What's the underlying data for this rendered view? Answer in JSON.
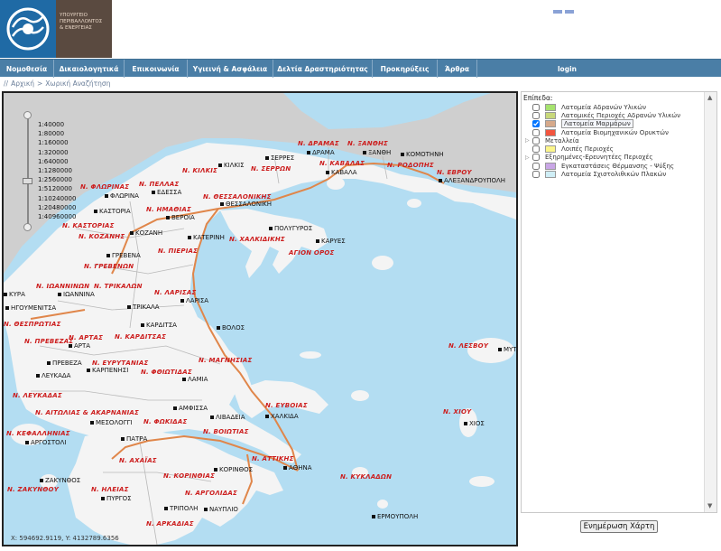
{
  "header": {
    "logo_text": [
      "ΥΠΟΥΡΓΕΙΟ",
      "ΠΕΡΙΒΑΛΛΟΝΤΟΣ",
      "& ΕΝΕΡΓΕΙΑΣ"
    ]
  },
  "nav": {
    "items": [
      "Νομοθεσία",
      "Δικαιολογητικά",
      "Επικοινωνία",
      "Υγιεινή & Ασφάλεια",
      "Δελτία Δραστηριότητας",
      "Προκηρύξεις",
      "Άρθρα"
    ],
    "login": "login"
  },
  "breadcrumb": {
    "prefix": "//",
    "home": "Αρχική",
    "separator": ">",
    "current": "Χωρική Αναζήτηση"
  },
  "map": {
    "scales": [
      "1:40000",
      "1:80000",
      "1:160000",
      "1:320000",
      "1:640000",
      "1:1280000",
      "1:2560000",
      "1:5120000",
      "1:10240000",
      "1:20480000",
      "1:40960000"
    ],
    "coords": "X: 594692.9119, Y: 4132789.6356",
    "prefectures": [
      "Ν. ΔΡΑΜΑΣ",
      "Ν. ΞΑΝΘΗΣ",
      "Ν. ΚΑΒΑΛΑΣ",
      "Ν. ΡΟΔΟΠΗΣ",
      "Ν. ΕΒΡΟΥ",
      "Ν. ΚΙΛΚΙΣ",
      "Ν. ΣΕΡΡΩΝ",
      "Ν. ΠΕΛΛΑΣ",
      "Ν. ΦΛΩΡΙΝΑΣ",
      "Ν. ΘΕΣΣΑΛΟΝΙΚΗΣ",
      "Ν. ΗΜΑΘΙΑΣ",
      "Ν. ΚΑΣΤΟΡΙΑΣ",
      "Ν. ΚΟΖΑΝΗΣ",
      "Ν. ΧΑΛΚΙΔΙΚΗΣ",
      "ΑΓΙΟΝ ΟΡΟΣ",
      "Ν. ΠΙΕΡΙΑΣ",
      "Ν. ΓΡΕΒΕΝΩΝ",
      "Ν. ΙΩΑΝΝΙΝΩΝ",
      "Ν. ΤΡΙΚΑΛΩΝ",
      "Ν. ΛΑΡΙΣΑΣ",
      "Ν. ΘΕΣΠΡΩΤΙΑΣ",
      "Ν. ΠΡΕΒΕΖΑΣ",
      "Ν. ΑΡΤΑΣ",
      "Ν. ΚΑΡΔΙΤΣΑΣ",
      "Ν. ΜΑΓΝΗΣΙΑΣ",
      "Ν. ΕΥΡΥΤΑΝΙΑΣ",
      "Ν. ΦΘΙΩΤΙΔΑΣ",
      "Ν. ΛΕΥΚΑΔΑΣ",
      "Ν. ΑΙΤΩΛΙΑΣ & ΑΚΑΡΝΑΝΙΑΣ",
      "Ν. ΦΩΚΙΔΑΣ",
      "Ν. ΒΟΙΩΤΙΑΣ",
      "Ν. ΕΥΒΟΙΑΣ",
      "Ν. ΚΕΦΑΛΛΗΝΙΑΣ",
      "Ν. ΑΧΑΪΑΣ",
      "Ν. ΚΟΡΙΝΘΙΑΣ",
      "Ν. ΑΤΤΙΚΗΣ",
      "Ν. ΚΥΚΛΑΔΩΝ",
      "Ν. ΖΑΚΥΝΘΟΥ",
      "Ν. ΗΛΕΙΑΣ",
      "Ν. ΑΡΓΟΛΙΔΑΣ",
      "Ν. ΑΡΚΑΔΙΑΣ",
      "Ν. ΛΕΣΒΟΥ",
      "Ν. ΧΙΟΥ"
    ],
    "cities": [
      "ΔΡΑΜΑ",
      "ΞΑΝΘΗ",
      "ΚΟΜΟΤΗΝΗ",
      "ΚΑΒΑΛΑ",
      "ΑΛΕΞΑΝΔΡΟΥΠΟΛΗ",
      "ΚΙΛΚΙΣ",
      "ΣΕΡΡΕΣ",
      "ΕΔΕΣΣΑ",
      "ΦΛΩΡΙΝΑ",
      "ΘΕΣΣΑΛΟΝΙΚΗ",
      "ΚΑΣΤΟΡΙΑ",
      "ΒΕΡΟΙΑ",
      "ΚΟΖΑΝΗ",
      "ΚΑΤΕΡΙΝΗ",
      "ΠΟΛΥΓΥΡΟΣ",
      "ΚΑΡΥΕΣ",
      "ΓΡΕΒΕΝΑ",
      "ΙΩΑΝΝΙΝΑ",
      "ΚΥΡΑ",
      "ΗΓΟΥΜΕΝΙΤΣΑ",
      "ΤΡΙΚΑΛΑ",
      "ΛΑΡΙΣΑ",
      "ΚΑΡΔΙΤΣΑ",
      "ΒΟΛΟΣ",
      "ΑΡΤΑ",
      "ΠΡΕΒΕΖΑ",
      "ΚΑΡΠΕΝΗΣΙ",
      "ΛΕΥΚΑΔΑ",
      "ΛΑΜΙΑ",
      "ΑΜΦΙΣΣΑ",
      "ΛΙΒΑΔΕΙΑ",
      "ΧΑΛΚΙΔΑ",
      "ΜΕΣΟΛΟΓΓΙ",
      "ΑΡΓΟΣΤΟΛΙ",
      "ΠΑΤΡΑ",
      "ΚΟΡΙΝΘΟΣ",
      "ΑΘΗΝΑ",
      "ΖΑΚΥΝΘΟΣ",
      "ΠΥΡΓΟΣ",
      "ΤΡΙΠΟΛΗ",
      "ΝΑΥΠΛΙΟ",
      "ΕΡΜΟΥΠΟΛΗ",
      "ΜΥΤΙ",
      "ΧΙΟΣ"
    ]
  },
  "layers": {
    "title": "Επίπεδα:",
    "items": [
      {
        "label": "Λατομεία Αδρανών Υλικών",
        "color": "#a6e36e",
        "checked": false,
        "expandable": false,
        "selected": false
      },
      {
        "label": "Λατομικές Περιοχές Αδρανών Υλικών",
        "color": "#c8d87a",
        "checked": false,
        "expandable": false,
        "selected": false
      },
      {
        "label": "Λατομεία Μαρμάρων",
        "color": "#d6a98a",
        "checked": true,
        "expandable": false,
        "selected": true
      },
      {
        "label": "Λατομεία Βιομηχανικών Ορυκτών",
        "color": "#f2553f",
        "checked": false,
        "expandable": false,
        "selected": false
      },
      {
        "label": "Μεταλλεία",
        "color": "",
        "checked": false,
        "expandable": true,
        "selected": false
      },
      {
        "label": "Λοιπές Περιοχές",
        "color": "#fbf58a",
        "checked": false,
        "expandable": false,
        "selected": false
      },
      {
        "label": "Εξηρημένες-Ερευνητέες Περιοχές",
        "color": "",
        "checked": false,
        "expandable": true,
        "selected": false
      },
      {
        "label": "Εγκαταστάσεις Θέρμανσης - Ψύξης",
        "color": "#c9a6e6",
        "checked": false,
        "expandable": false,
        "selected": false
      },
      {
        "label": "Λατομεία Σχιστολιθικών Πλακών",
        "color": "#cfeef6",
        "checked": false,
        "expandable": false,
        "selected": false
      }
    ]
  },
  "update_button": "Ενημέρωση Χάρτη",
  "colors": {
    "nav_bg": "#4a7ea6",
    "sea": "#b3ddf2",
    "land": "#f4f4f4",
    "outside_land": "#cfcfcf",
    "prefecture_label": "#cc1d1d",
    "road": "#e0864a"
  }
}
